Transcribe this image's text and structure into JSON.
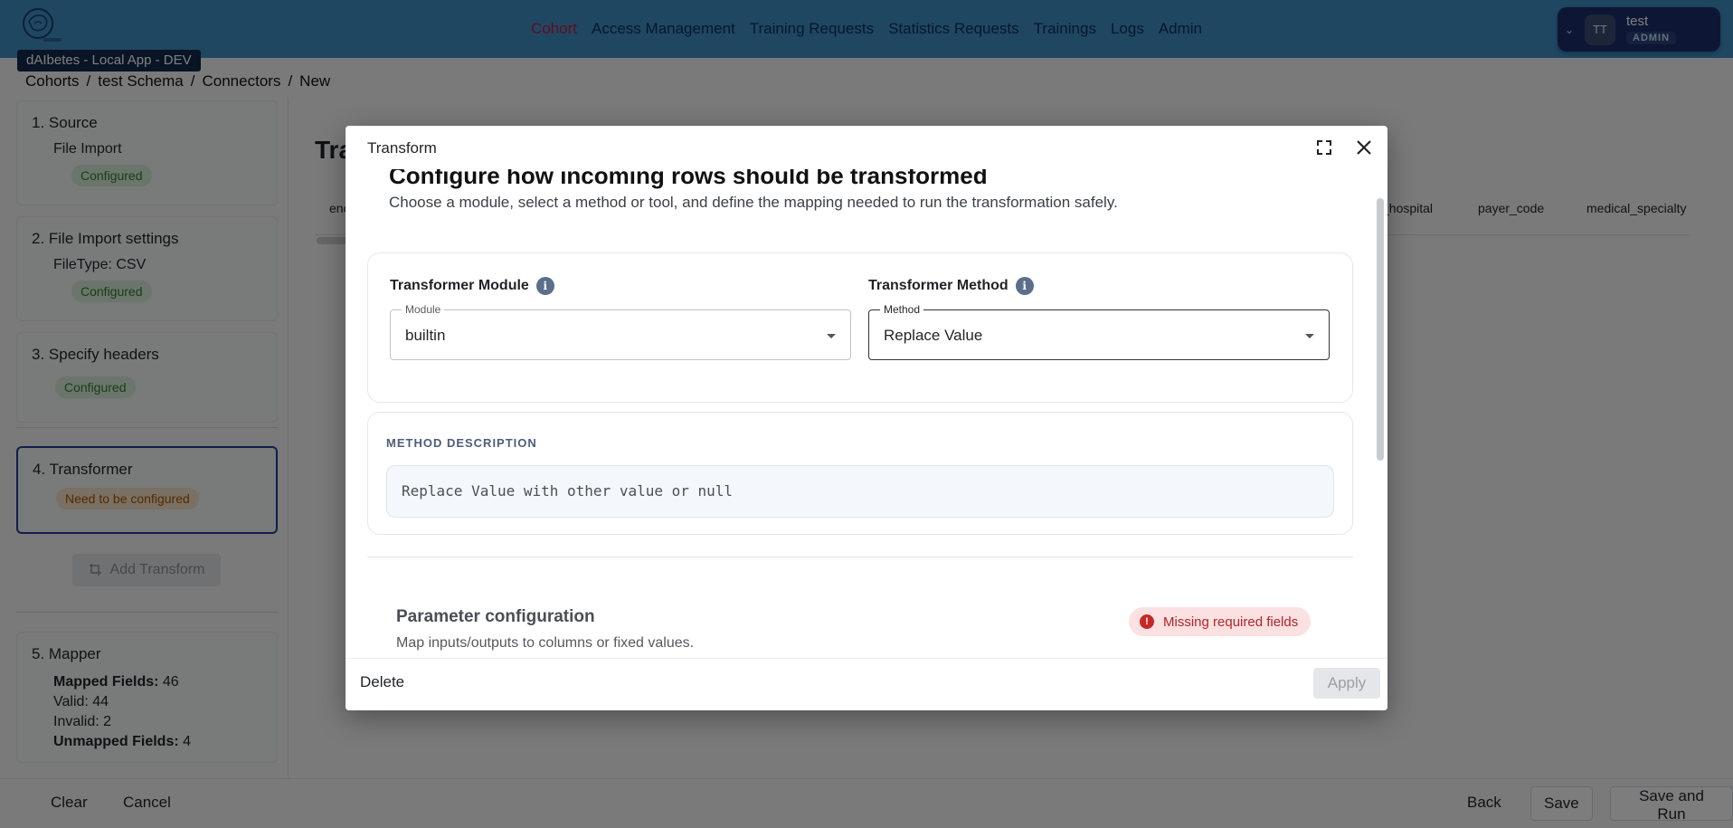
{
  "app": {
    "env_label": "dAIbetes - Local App - DEV"
  },
  "nav": {
    "items": [
      "Cohort",
      "Access Management",
      "Training Requests",
      "Statistics Requests",
      "Trainings",
      "Logs",
      "Admin"
    ]
  },
  "user": {
    "initials": "TT",
    "name": "test",
    "role": "ADMIN"
  },
  "breadcrumb": [
    "Cohorts",
    "test Schema",
    "Connectors",
    "New"
  ],
  "steps": {
    "source": {
      "title": "1.   Source",
      "sub": "File Import",
      "status": "Configured"
    },
    "import_settings": {
      "title": "2.   File Import settings",
      "sub": "FileType: CSV",
      "status": "Configured"
    },
    "headers": {
      "title": "3.   Specify headers",
      "status": "Configured"
    },
    "transformer": {
      "title": "4.   Transformer",
      "status": "Need to be configured"
    },
    "add_transform": "Add Transform",
    "mapper": {
      "title": "5.   Mapper",
      "mapped_label": "Mapped Fields:",
      "mapped_value": "46",
      "valid": "Valid: 44",
      "invalid": "Invalid: 2",
      "unmapped_label": "Unmapped Fields:",
      "unmapped_value": "4"
    }
  },
  "background": {
    "title": "Tra",
    "columns": [
      "enc",
      "_hospital",
      "payer_code",
      "medical_specialty"
    ]
  },
  "bottom": {
    "clear": "Clear",
    "cancel": "Cancel",
    "back": "Back",
    "save": "Save",
    "save_run": "Save and Run"
  },
  "modal": {
    "title": "Transform",
    "heading": "Configure how incoming rows should be transformed",
    "description": "Choose a module, select a method or tool, and define the mapping needed to run the transformation safely.",
    "module_label": "Transformer Module",
    "module_legend": "Module",
    "module_value": "builtin",
    "method_label": "Transformer Method",
    "method_legend": "Method",
    "method_value": "Replace Value",
    "method_desc_label": "METHOD DESCRIPTION",
    "method_desc_text": "Replace Value with other value or null",
    "param_title": "Parameter configuration",
    "param_sub": "Map inputs/outputs to columns or fixed values.",
    "missing": "Missing required fields",
    "delete": "Delete",
    "apply": "Apply"
  },
  "colors": {
    "topbar": "#3f8fc4",
    "nav_active": "#c21a3a",
    "configured_bg": "#d8ead6",
    "warn_bg": "#f5e0c6",
    "error": "#c62828"
  }
}
